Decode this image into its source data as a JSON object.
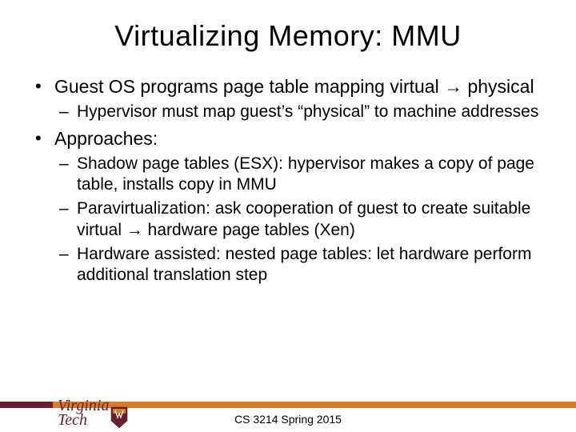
{
  "title": "Virtualizing Memory: MMU",
  "bullets": {
    "b1": "Guest OS programs page table mapping virtual → physical",
    "b1_1": "Hypervisor must map guest’s “physical” to machine addresses",
    "b2": "Approaches:",
    "b2_1": "Shadow page tables (ESX): hypervisor makes a copy of page table, installs copy in MMU",
    "b2_2": "Paravirtualization: ask cooperation of guest to create suitable virtual → hardware page tables (Xen)",
    "b2_3": "Hardware assisted: nested page tables: let hardware perform additional translation step"
  },
  "footer": "CS 3214 Spring 2015",
  "logo": {
    "line1": "Virginia",
    "line2": "Tech"
  },
  "colors": {
    "maroon": "#6a1f2e",
    "orange": "#d97b29"
  }
}
